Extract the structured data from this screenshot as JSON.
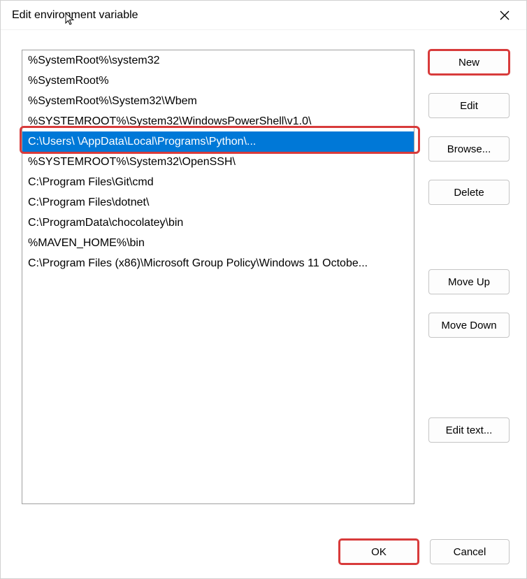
{
  "window": {
    "title": "Edit environment variable"
  },
  "list": {
    "items": [
      "%SystemRoot%\\system32",
      "%SystemRoot%",
      "%SystemRoot%\\System32\\Wbem",
      "%SYSTEMROOT%\\System32\\WindowsPowerShell\\v1.0\\",
      "C:\\Users\\                                           \\AppData\\Local\\Programs\\Python\\...",
      "%SYSTEMROOT%\\System32\\OpenSSH\\",
      "C:\\Program Files\\Git\\cmd",
      "C:\\Program Files\\dotnet\\",
      "C:\\ProgramData\\chocolatey\\bin",
      "%MAVEN_HOME%\\bin",
      "C:\\Program Files (x86)\\Microsoft Group Policy\\Windows 11 Octobe..."
    ],
    "selectedIndex": 4
  },
  "buttons": {
    "new": "New",
    "edit": "Edit",
    "browse": "Browse...",
    "delete": "Delete",
    "moveUp": "Move Up",
    "moveDown": "Move Down",
    "editText": "Edit text...",
    "ok": "OK",
    "cancel": "Cancel"
  },
  "highlights": {
    "newButton": true,
    "okButton": true,
    "selectedRow": true
  }
}
